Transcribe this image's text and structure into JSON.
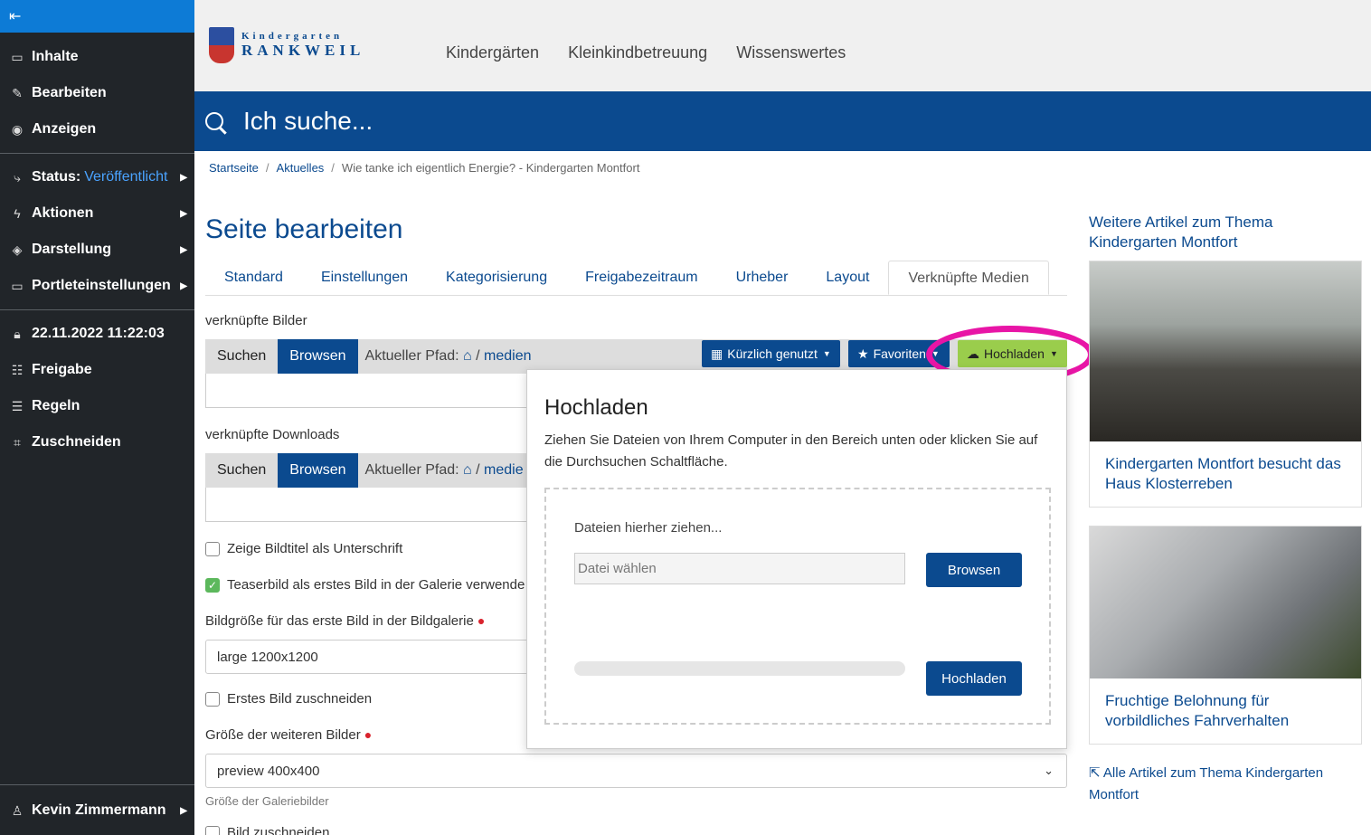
{
  "sidebar": {
    "collapse_icon": "collapse-left-icon",
    "items": [
      {
        "label": "Inhalte",
        "icon": "folder-icon"
      },
      {
        "label": "Bearbeiten",
        "icon": "pencil-icon"
      },
      {
        "label": "Anzeigen",
        "icon": "eye-icon"
      }
    ],
    "status_label": "Status:",
    "status_value": "Veröffentlicht",
    "actions": "Aktionen",
    "display": "Darstellung",
    "portlets": "Portleteinstellungen",
    "date": "22.11.2022 11:22:03",
    "share": "Freigabe",
    "rules": "Regeln",
    "crop": "Zuschneiden",
    "user": "Kevin Zimmermann"
  },
  "header": {
    "logo_line1": "Kindergarten",
    "logo_line2": "RANKWEIL",
    "nav": [
      "Kindergärten",
      "Kleinkindbetreuung",
      "Wissenswertes"
    ],
    "search_placeholder": "Ich suche..."
  },
  "breadcrumb": [
    "Startseite",
    "Aktuelles",
    "Wie tanke ich eigentlich Energie? - Kindergarten Montfort"
  ],
  "main": {
    "title": "Seite bearbeiten",
    "tabs": [
      "Standard",
      "Einstellungen",
      "Kategorisierung",
      "Freigabezeitraum",
      "Urheber",
      "Layout",
      "Verknüpfte Medien"
    ],
    "linked_images_label": "verknüpfte Bilder",
    "linked_downloads_label": "verknüpfte Downloads",
    "search_btn": "Suchen",
    "browse_btn": "Browsen",
    "path_label": "Aktueller Pfad:",
    "path_value": "medien",
    "path_value_trunc": "medie",
    "recent_btn": "Kürzlich genutzt",
    "favorites_btn": "Favoriten",
    "upload_btn": "Hochladen",
    "chk_caption": "Zeige Bildtitel als Unterschrift",
    "chk_teaser": "Teaserbild als erstes Bild in der Galerie verwende",
    "first_size_label": "Bildgröße für das erste Bild in der Bildgalerie",
    "first_size_value": "large 1200x1200",
    "chk_crop_first": "Erstes Bild zuschneiden",
    "other_size_label": "Größe der weiteren Bilder",
    "other_size_value": "preview 400x400",
    "other_size_hint": "Größe der Galeriebilder",
    "chk_crop": "Bild zuschneiden"
  },
  "popup": {
    "title": "Hochladen",
    "description": "Ziehen Sie Dateien von Ihrem Computer in den Bereich unten oder klicken Sie auf die Durchsuchen Schaltfläche.",
    "drop_label": "Dateien hierher ziehen...",
    "file_placeholder": "Datei wählen",
    "browse_btn": "Browsen",
    "upload_btn": "Hochladen"
  },
  "right": {
    "title": "Weitere Artikel zum Thema Kindergarten Montfort",
    "cards": [
      {
        "caption": "Kindergarten Montfort besucht das Haus Klosterreben"
      },
      {
        "caption": "Fruchtige Belohnung für vorbildliches Fahrverhalten"
      }
    ],
    "all_link": "Alle Artikel zum Thema Kindergarten Montfort"
  },
  "colors": {
    "brand": "#0b4a8f",
    "highlight": "#e815a6",
    "upload_green": "#9acd4c"
  }
}
